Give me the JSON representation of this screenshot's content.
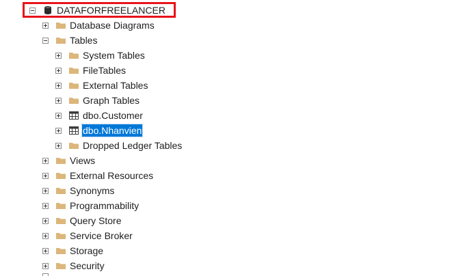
{
  "database": {
    "name": "DATAFORFREELANCER",
    "expanded": true,
    "icon": "database-icon",
    "highlight_color": "#e8131a"
  },
  "nodes": {
    "database_diagrams": "Database Diagrams",
    "tables": "Tables",
    "system_tables": "System Tables",
    "filetables": "FileTables",
    "external_tables": "External Tables",
    "graph_tables": "Graph Tables",
    "dbo_customer": "dbo.Customer",
    "dbo_nhanvien": "dbo.Nhanvien",
    "dropped_ledger_tables": "Dropped Ledger Tables",
    "views": "Views",
    "external_resources": "External Resources",
    "synonyms": "Synonyms",
    "programmability": "Programmability",
    "query_store": "Query Store",
    "service_broker": "Service Broker",
    "storage": "Storage",
    "security": "Security"
  },
  "selected_node": "dbo.Nhanvien",
  "colors": {
    "folder": "#dcb67a",
    "selection": "#0078d7",
    "table_icon": "#3c3c3c"
  }
}
